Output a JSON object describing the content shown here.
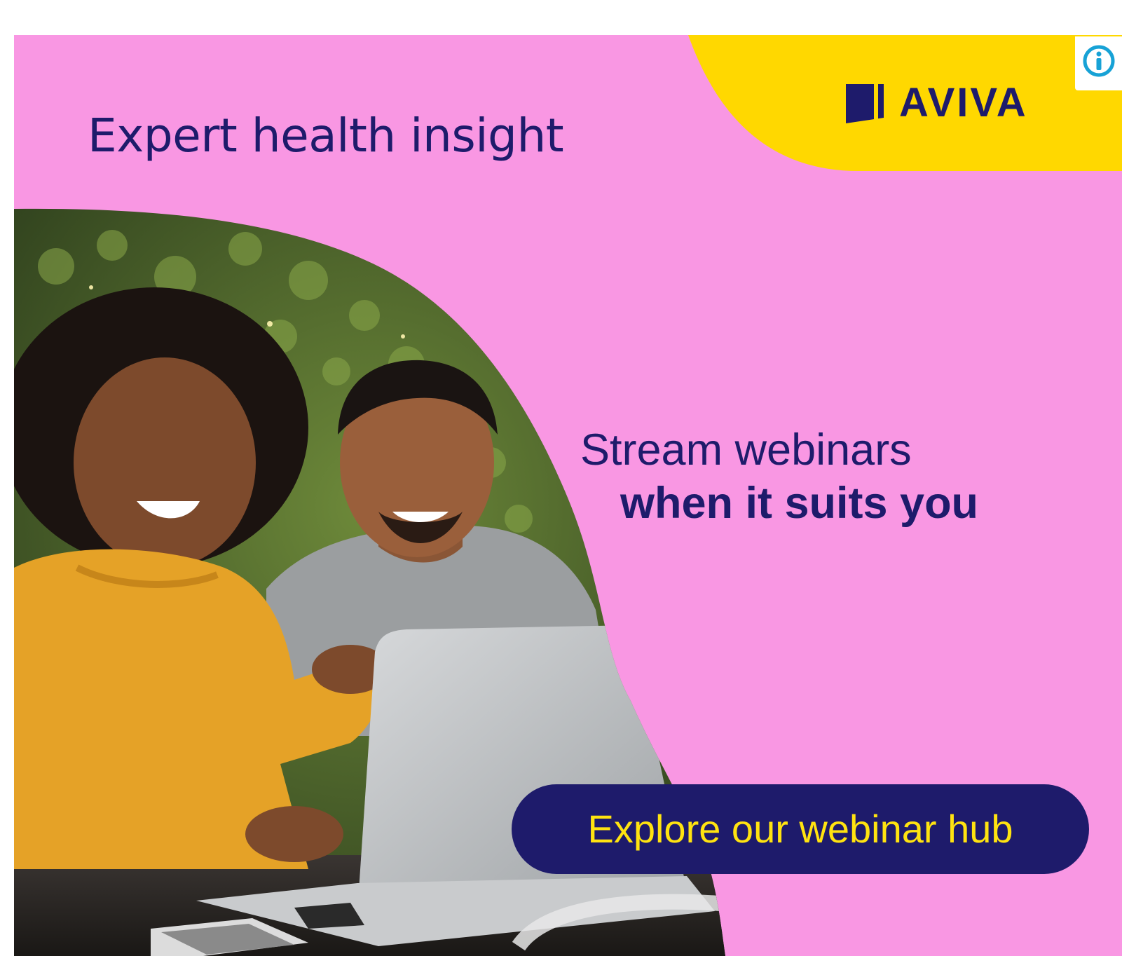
{
  "ad": {
    "headline": "Expert health insight",
    "subheadline_line1": "Stream webinars",
    "subheadline_line2": "when it suits you",
    "cta_label": "Explore our webinar hub",
    "brand": {
      "logo_text": "AVIVA",
      "logo_icon": "aviva-flag-icon"
    },
    "info_icon": "info-icon",
    "colors": {
      "background": "#f997e3",
      "brand_yellow": "#ffd800",
      "brand_navy": "#1e1b6b",
      "cta_text": "#ffe310",
      "info_cyan": "#17a2d6"
    },
    "photo_description_icon": "couple-laptop-photo"
  }
}
